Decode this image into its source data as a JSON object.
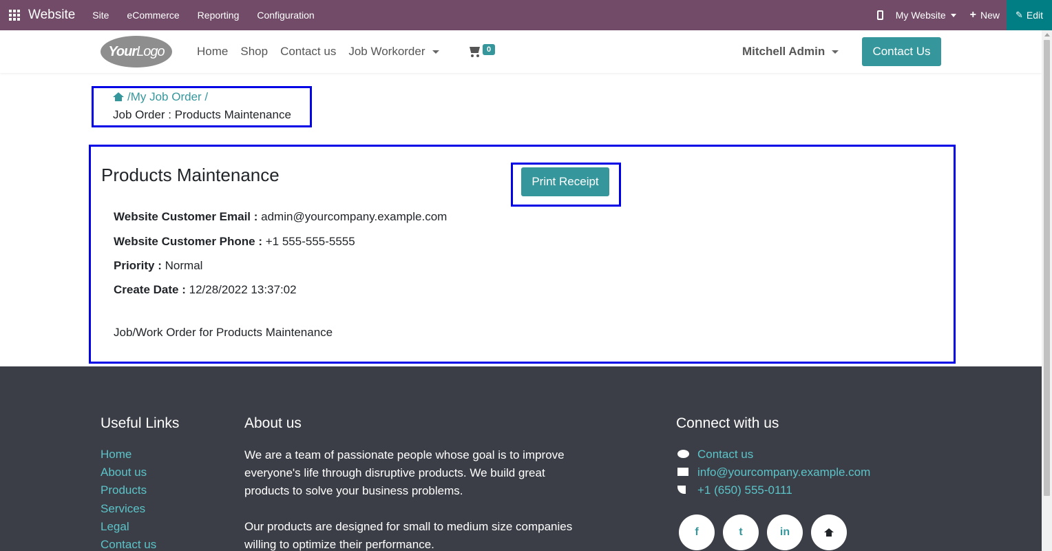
{
  "topbar": {
    "brand": "Website",
    "menus": [
      "Site",
      "eCommerce",
      "Reporting",
      "Configuration"
    ],
    "my_website": "My Website",
    "new_label": "New",
    "edit_label": "Edit"
  },
  "navbar": {
    "logo_text_bold": "Your",
    "logo_text": "Logo",
    "links": [
      "Home",
      "Shop",
      "Contact us",
      "Job Workorder"
    ],
    "cart_count": "0",
    "user": "Mitchell Admin",
    "contact_button": "Contact Us"
  },
  "breadcrumb": {
    "link": "/My Job Order /",
    "current": "Job Order : Products Maintenance"
  },
  "job_order": {
    "title": "Products Maintenance",
    "print_button": "Print Receipt",
    "fields": [
      {
        "label": "Website Customer Email :",
        "value": "admin@yourcompany.example.com"
      },
      {
        "label": "Website Customer Phone :",
        "value": "+1 555-555-5555"
      },
      {
        "label": "Priority :",
        "value": "Normal"
      },
      {
        "label": "Create Date :",
        "value": "12/28/2022 13:37:02"
      }
    ],
    "description": "Job/Work Order for Products Maintenance"
  },
  "footer": {
    "useful_links_title": "Useful Links",
    "useful_links": [
      "Home",
      "About us",
      "Products",
      "Services",
      "Legal",
      "Contact us"
    ],
    "about_title": "About us",
    "about_p1": "We are a team of passionate people whose goal is to improve everyone's life through disruptive products. We build great products to solve your business problems.",
    "about_p2": "Our products are designed for small to medium size companies willing to optimize their performance.",
    "connect_title": "Connect with us",
    "contact_us": "Contact us",
    "email": "info@yourcompany.example.com",
    "phone": "+1 (650) 555-0111",
    "social": [
      "f",
      "t",
      "in"
    ]
  }
}
